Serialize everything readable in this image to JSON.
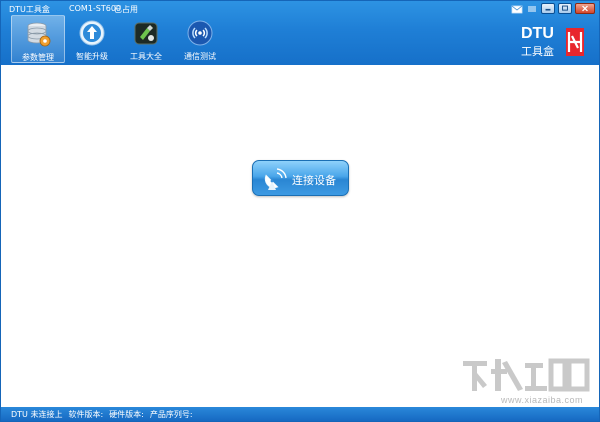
{
  "window": {
    "title": "DTU工具盒",
    "port": "COM1-ST600",
    "port_status": "已占用"
  },
  "toolbar": {
    "items": [
      {
        "label": "参数管理",
        "icon": "database-icon",
        "active": true
      },
      {
        "label": "智能升级",
        "icon": "upgrade-arrow-icon",
        "active": false
      },
      {
        "label": "工具大全",
        "icon": "toolbox-icon",
        "active": false
      },
      {
        "label": "通信测试",
        "icon": "signal-test-icon",
        "active": false
      }
    ]
  },
  "brand": {
    "line1": "DTU",
    "line2": "工具盒",
    "logo_color": "#e8262d"
  },
  "main": {
    "connect_label": "连接设备",
    "connect_icon": "satellite-dish-icon"
  },
  "watermark": {
    "text": "www.xiazaiba.com"
  },
  "statusbar": {
    "connection": "DTU 未连接上",
    "software_version": "软件版本:",
    "hardware_version": "硬件版本:",
    "serial_number": "产品序列号:"
  },
  "colors": {
    "header": "#1f7fd6",
    "button": "#3d9ae3"
  }
}
